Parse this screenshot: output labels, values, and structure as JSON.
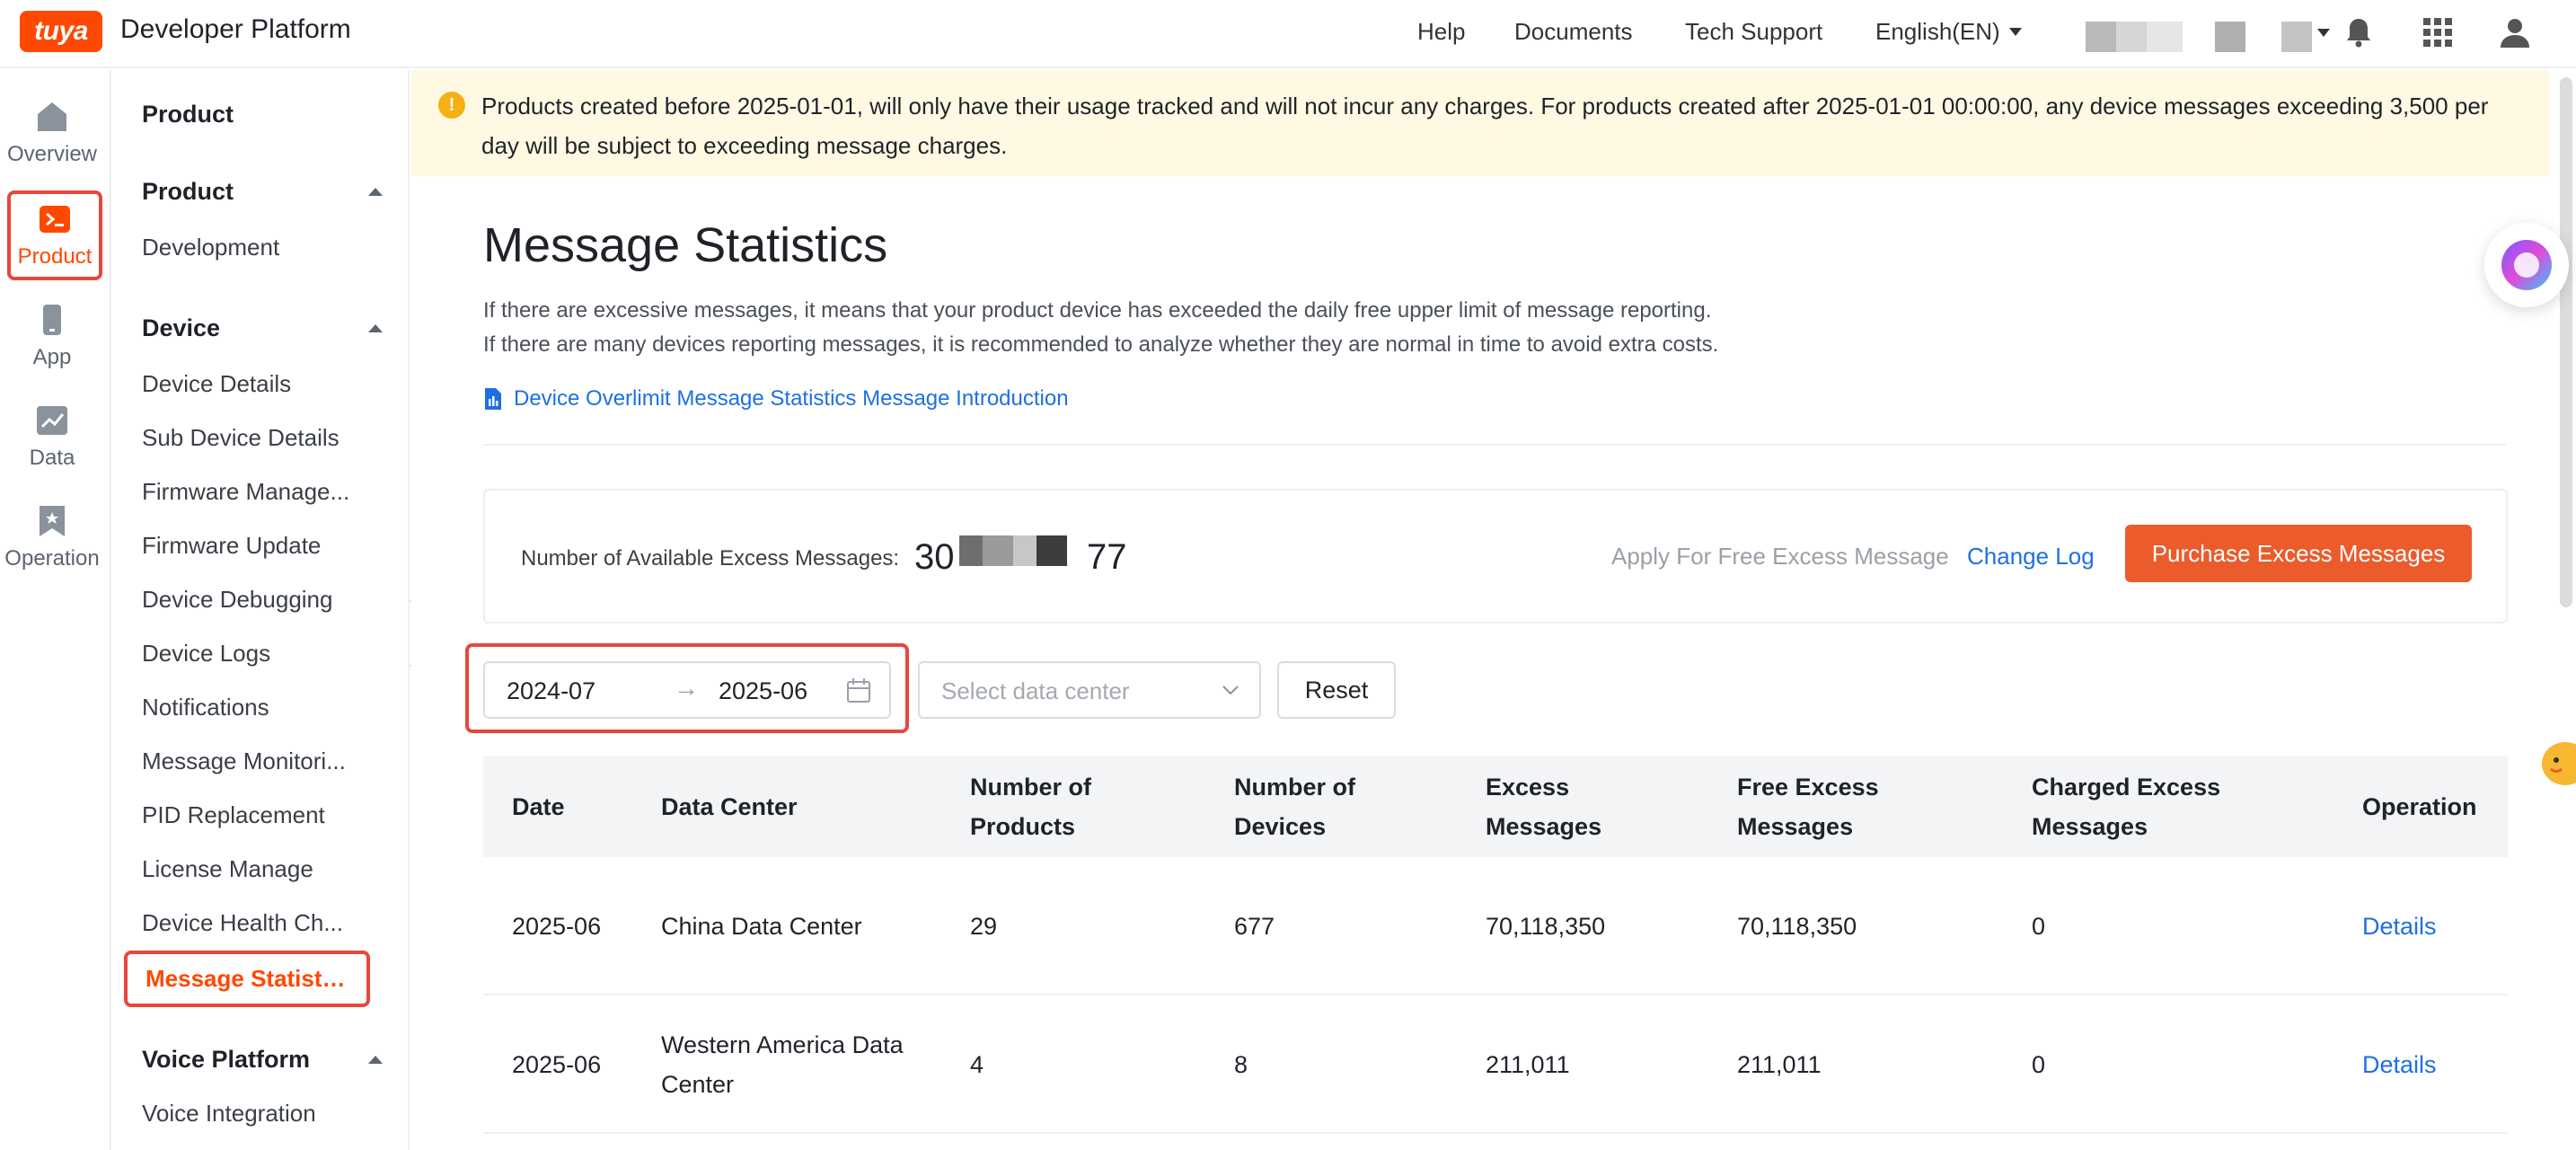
{
  "header": {
    "logo_text": "tuya",
    "platform_name": "Developer Platform",
    "nav": [
      "Help",
      "Documents",
      "Tech Support"
    ],
    "language": "English(EN)"
  },
  "rail": {
    "items": [
      {
        "label": "Overview",
        "icon": "home-icon"
      },
      {
        "label": "Product",
        "icon": "terminal-icon"
      },
      {
        "label": "App",
        "icon": "phone-icon"
      },
      {
        "label": "Data",
        "icon": "chart-icon"
      },
      {
        "label": "Operation",
        "icon": "bookmark-icon"
      }
    ],
    "active": "Product"
  },
  "subnav": {
    "title": "Product",
    "groups": [
      {
        "label": "Product",
        "items": [
          "Development"
        ]
      },
      {
        "label": "Device",
        "items": [
          "Device Details",
          "Sub Device Details",
          "Firmware Manage...",
          "Firmware Update",
          "Device Debugging",
          "Device Logs",
          "Notifications",
          "Message Monitori...",
          "PID Replacement",
          "License Manage",
          "Device Health Ch...",
          "Message Statistics"
        ]
      },
      {
        "label": "Voice Platform",
        "items": [
          "Voice Integration"
        ]
      }
    ],
    "active": "Message Statistics"
  },
  "notice": {
    "text": "Products created before 2025-01-01, will only have their usage tracked and will not incur any charges. For products created after 2025-01-01 00:00:00, any device messages exceeding 3,500 per day will be subject to exceeding message charges."
  },
  "page": {
    "title": "Message Statistics",
    "desc_1": "If there are excessive messages, it means that your product device has exceeded the daily free upper limit of message reporting.",
    "desc_2": "If there are many devices reporting messages, it is recommended to analyze whether they are normal in time to avoid extra costs.",
    "intro_link": "Device Overlimit Message Statistics Message Introduction"
  },
  "excess": {
    "label": "Number of Available Excess Messages:",
    "value_prefix": "30",
    "value_suffix": "77",
    "apply_link": "Apply For Free Excess Message",
    "changelog_link": "Change Log",
    "purchase_button": "Purchase Excess Messages"
  },
  "filters": {
    "range_start": "2024-07",
    "range_arrow": "→",
    "range_end": "2025-06",
    "datacenter_placeholder": "Select data center",
    "reset_button": "Reset"
  },
  "table": {
    "columns": [
      "Date",
      "Data Center",
      "Number of Products",
      "Number of Devices",
      "Excess Messages",
      "Free Excess Messages",
      "Charged Excess Messages",
      "Operation"
    ],
    "rows": [
      [
        "2025-06",
        "China Data Center",
        "29",
        "677",
        "70,118,350",
        "70,118,350",
        "0",
        "Details"
      ],
      [
        "2025-06",
        "Western America Data Center",
        "4",
        "8",
        "211,011",
        "211,011",
        "0",
        "Details"
      ]
    ]
  },
  "colors": {
    "brand": "#ff4800",
    "button": "#ec5b2c",
    "link": "#1e6fe6",
    "highlight": "#e8473c",
    "notice_bg": "#fff8e3"
  }
}
